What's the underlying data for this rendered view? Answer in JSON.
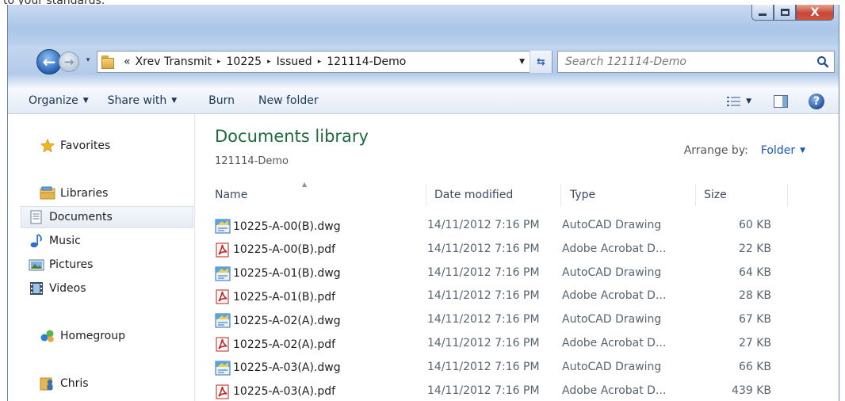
{
  "top_strip_text": "to your standards.",
  "window": {
    "caption_buttons": {
      "minimize": "—",
      "maximize": "□",
      "close": "X"
    }
  },
  "nav": {
    "back_label": "←",
    "forward_label": "→",
    "history_label": "▾",
    "breadcrumb": [
      "«",
      "Xrev Transmit",
      "10225",
      "Issued",
      "121114-Demo"
    ],
    "breadcrumb_separator": "▸",
    "refresh_label": "⇆",
    "search_placeholder": "Search 121114-Demo"
  },
  "toolbar": {
    "organize": "Organize",
    "share_with": "Share with",
    "burn": "Burn",
    "new_folder": "New folder",
    "caret": "▼",
    "help": "?"
  },
  "sidebar": {
    "favorites": "Favorites",
    "libraries": "Libraries",
    "library_items": [
      "Documents",
      "Music",
      "Pictures",
      "Videos"
    ],
    "homegroup": "Homegroup",
    "user": "Chris"
  },
  "content": {
    "title": "Documents library",
    "subtitle": "121114-Demo",
    "arrange_label": "Arrange by:",
    "arrange_value": "Folder",
    "columns": {
      "name": "Name",
      "date": "Date modified",
      "type": "Type",
      "size": "Size"
    },
    "files": [
      {
        "name": "10225-A-00(B).dwg",
        "date": "14/11/2012 7:16 PM",
        "type": "AutoCAD Drawing",
        "size": "60 KB",
        "icon": "dwg-file-icon"
      },
      {
        "name": "10225-A-00(B).pdf",
        "date": "14/11/2012 7:16 PM",
        "type": "Adobe Acrobat D...",
        "size": "22 KB",
        "icon": "pdf-file-icon"
      },
      {
        "name": "10225-A-01(B).dwg",
        "date": "14/11/2012 7:16 PM",
        "type": "AutoCAD Drawing",
        "size": "64 KB",
        "icon": "dwg-file-icon"
      },
      {
        "name": "10225-A-01(B).pdf",
        "date": "14/11/2012 7:16 PM",
        "type": "Adobe Acrobat D...",
        "size": "28 KB",
        "icon": "pdf-file-icon"
      },
      {
        "name": "10225-A-02(A).dwg",
        "date": "14/11/2012 7:16 PM",
        "type": "AutoCAD Drawing",
        "size": "67 KB",
        "icon": "dwg-file-icon"
      },
      {
        "name": "10225-A-02(A).pdf",
        "date": "14/11/2012 7:16 PM",
        "type": "Adobe Acrobat D...",
        "size": "27 KB",
        "icon": "pdf-file-icon"
      },
      {
        "name": "10225-A-03(A).dwg",
        "date": "14/11/2012 7:16 PM",
        "type": "AutoCAD Drawing",
        "size": "66 KB",
        "icon": "dwg-file-icon"
      },
      {
        "name": "10225-A-03(A).pdf",
        "date": "14/11/2012 7:16 PM",
        "type": "Adobe Acrobat D...",
        "size": "439 KB",
        "icon": "pdf-file-icon"
      }
    ]
  },
  "colors": {
    "title_green": "#1e6b3c",
    "link_blue": "#1a56b3",
    "chrome_blue": "#aac5e8"
  }
}
